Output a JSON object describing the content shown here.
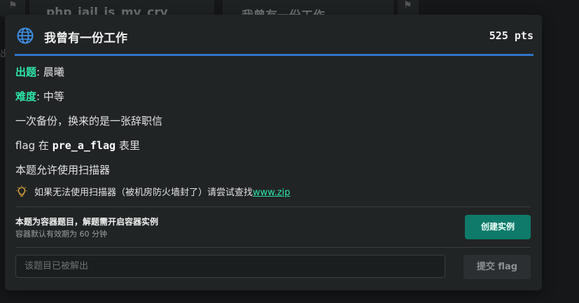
{
  "background": {
    "cards": [
      {
        "title": "php_jail_is_my_cry"
      },
      {
        "title": "我曾有一份工作"
      }
    ],
    "side_fragment": "出"
  },
  "challenge": {
    "icon": "globe-icon",
    "title": "我曾有一份工作",
    "points": "525 pts",
    "author_key": "出题",
    "author_value": "晨曦",
    "difficulty_key": "难度",
    "difficulty_value": "中等",
    "meta_separator": ":",
    "description_line1": "一次备份，换来的是一张辞职信",
    "flag_line_prefix": "flag 在",
    "flag_table": "pre_a_flag",
    "flag_line_suffix": "表里",
    "scanner_line": "本题允许使用扫描器",
    "hint_icon": "lightbulb-icon",
    "hint_text": "如果无法使用扫描器（被机房防火墙封了）请尝试查找",
    "hint_link": "www.zip"
  },
  "container": {
    "title": "本题为容器题目，解题需开启容器实例",
    "subtitle": "容器默认有效期为 60 分钟",
    "create_button": "创建实例"
  },
  "submission": {
    "placeholder": "该题目已被解出",
    "submit_button": "提交 flag"
  },
  "colors": {
    "accent_green": "#2ee6a8",
    "header_rule": "#2f74c8",
    "create_button_bg": "#0f7a6a",
    "modal_bg": "#212425",
    "page_bg": "#151718"
  }
}
